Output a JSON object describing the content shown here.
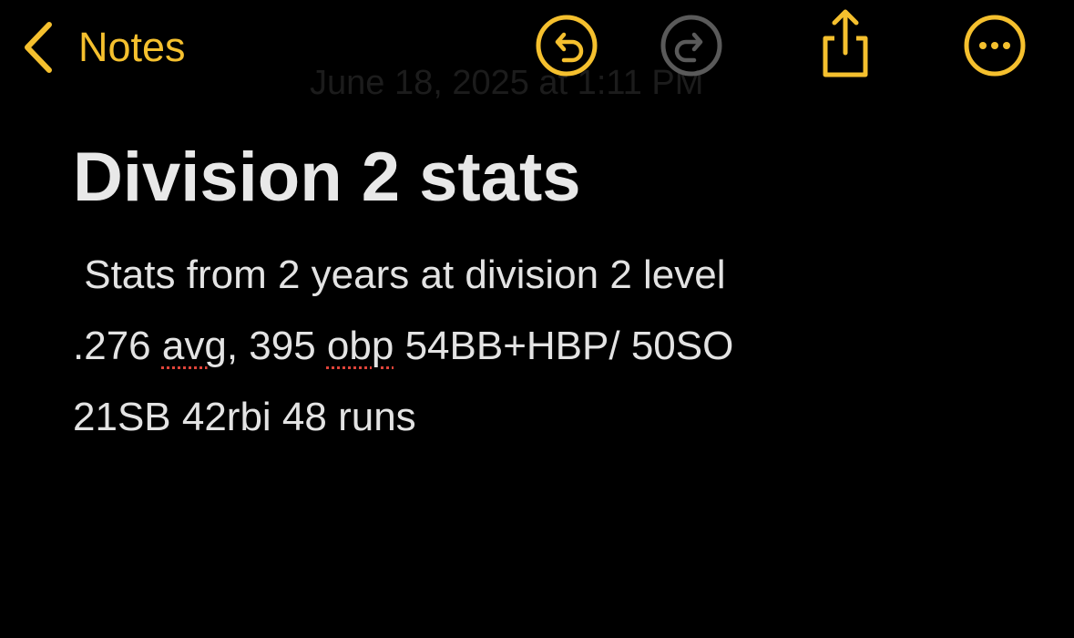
{
  "navbar": {
    "back_label": "Notes",
    "date_text": "June 18, 2025 at 1:11 PM",
    "icons": {
      "back": "chevron-left-icon",
      "undo": "undo-icon",
      "redo": "redo-icon",
      "share": "share-icon",
      "more": "more-icon"
    }
  },
  "note": {
    "title": "Division 2 stats",
    "line1": " Stats from 2 years at division 2 level",
    "line2": {
      "part1": ".276 ",
      "word1": "avg",
      "part2": ", 395 ",
      "word2": "obp",
      "part3": " 54BB+HBP/ 50SO"
    },
    "line3": "21SB 42rbi 48 runs"
  },
  "colors": {
    "accent": "#f5c02e",
    "disabled_icon": "#5a5a5a",
    "background": "#000000",
    "text": "#e6e6e6",
    "spellcheck_underline": "#e0443a"
  }
}
